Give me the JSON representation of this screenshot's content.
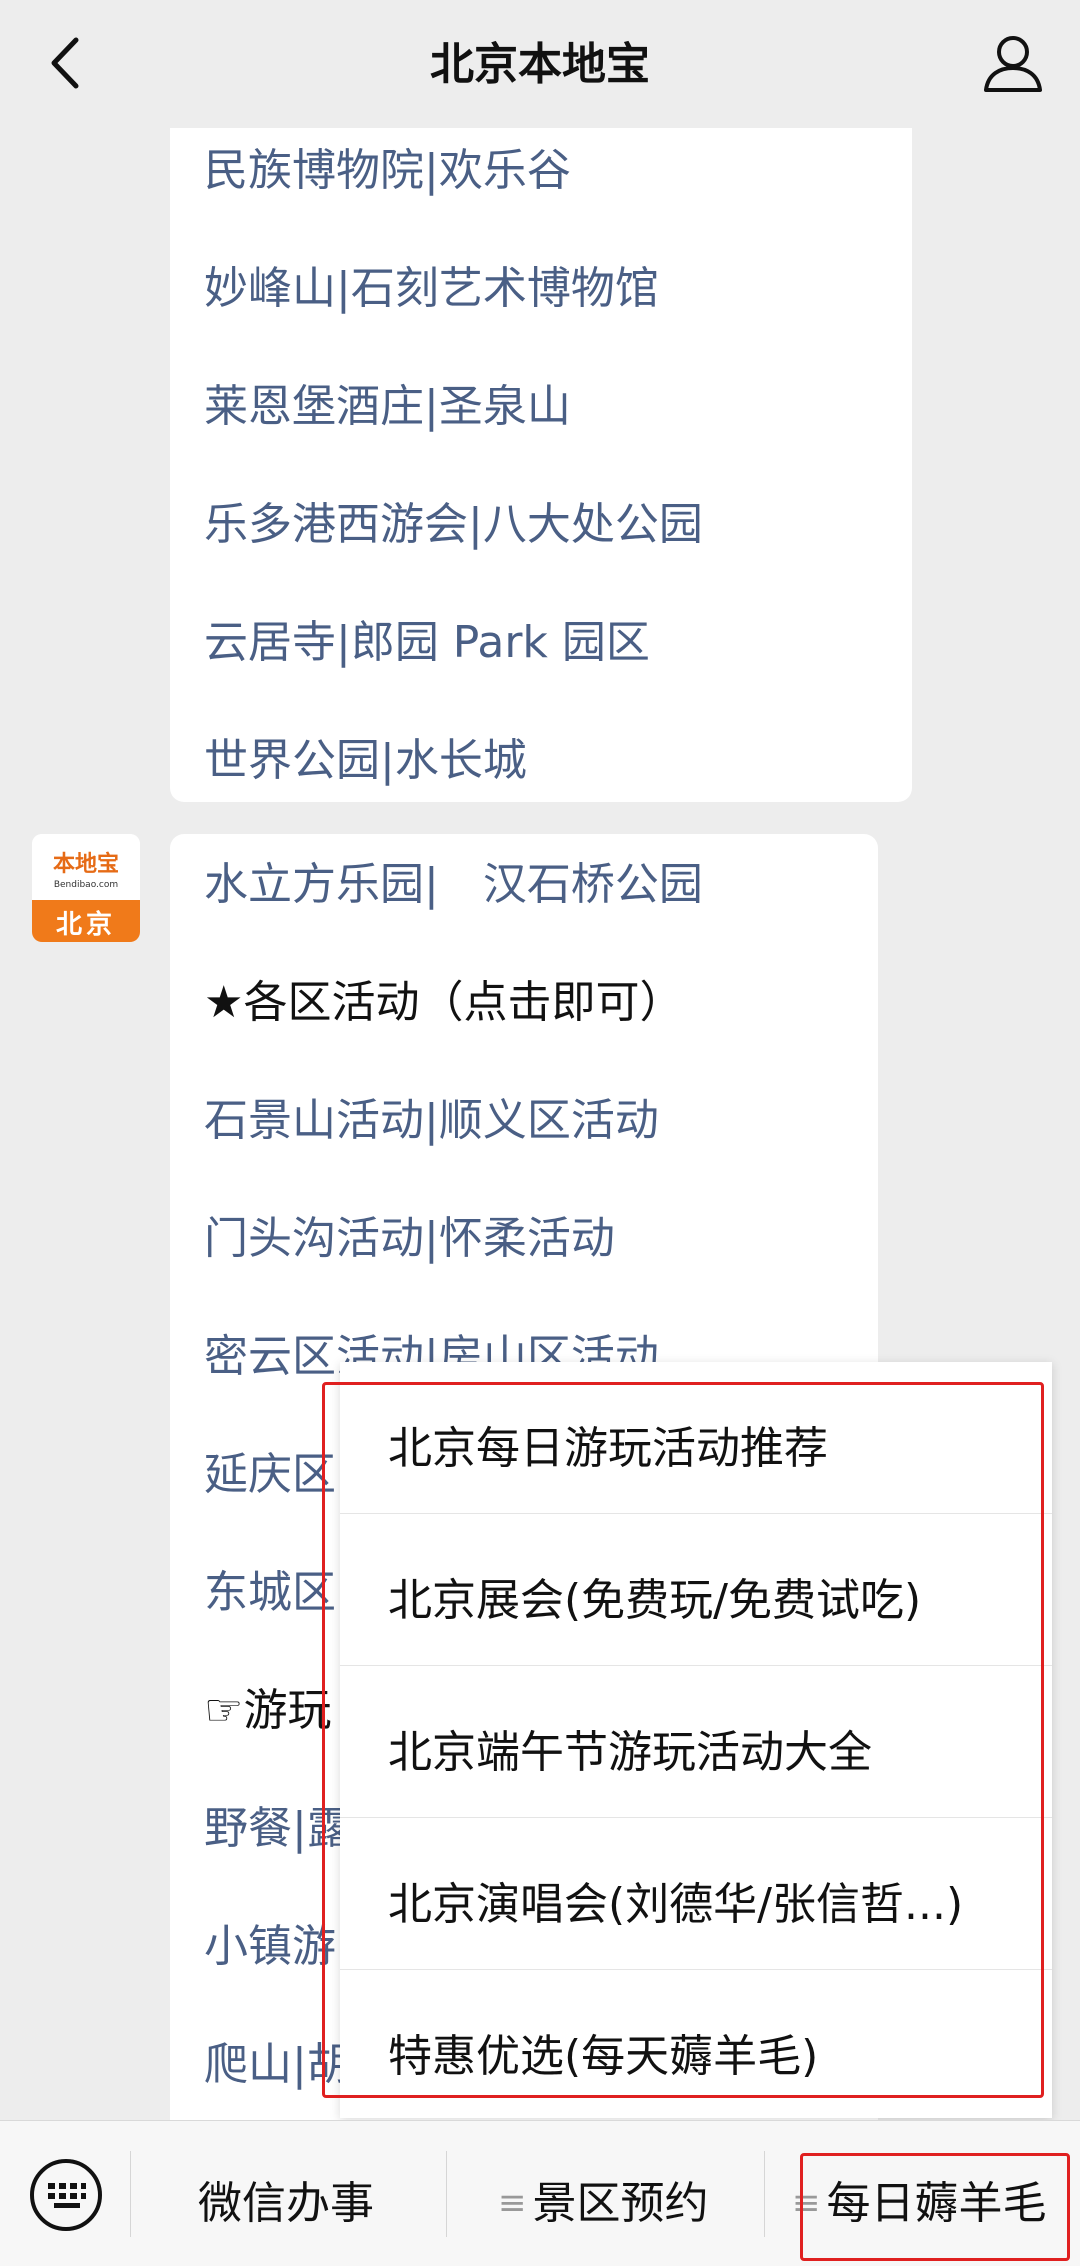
{
  "header": {
    "title": "北京本地宝",
    "back_icon": "chevron-left-icon",
    "profile_icon": "person-icon"
  },
  "message1": {
    "lines": [
      "民族博物院|欢乐谷",
      "妙峰山|石刻艺术博物馆",
      "莱恩堡酒庄|圣泉山",
      "乐多港西游会|八大处公园",
      "云居寺|郎园 Park 园区",
      "世界公园|水长城"
    ]
  },
  "avatar": {
    "logo": "本地宝",
    "sub": "Bendibao.com",
    "city": "北京"
  },
  "message2": {
    "lines": [
      "水立方乐园|　汉石桥公园",
      "★各区活动（点击即可）",
      "石景山活动|顺义区活动",
      "门头沟活动|怀柔活动",
      "密云区活动|房山区活动",
      "延庆区",
      "东城区",
      "☞游玩",
      "野餐|露",
      "小镇游",
      "爬山|胡"
    ]
  },
  "popup": {
    "items": [
      "北京每日游玩活动推荐",
      "北京展会(免费玩/免费试吃)",
      "北京端午节游玩活动大全",
      "北京演唱会(刘德华/张信哲...)",
      "特惠优选(每天薅羊毛)"
    ]
  },
  "bottombar": {
    "keyboard_icon": "keyboard-icon",
    "tabs": [
      "微信办事",
      "景区预约",
      "每日薅羊毛"
    ],
    "menu_glyph": "≡"
  },
  "colors": {
    "link": "#4a5f85",
    "highlight": "#e02020",
    "avatar_orange": "#f07a1a"
  }
}
